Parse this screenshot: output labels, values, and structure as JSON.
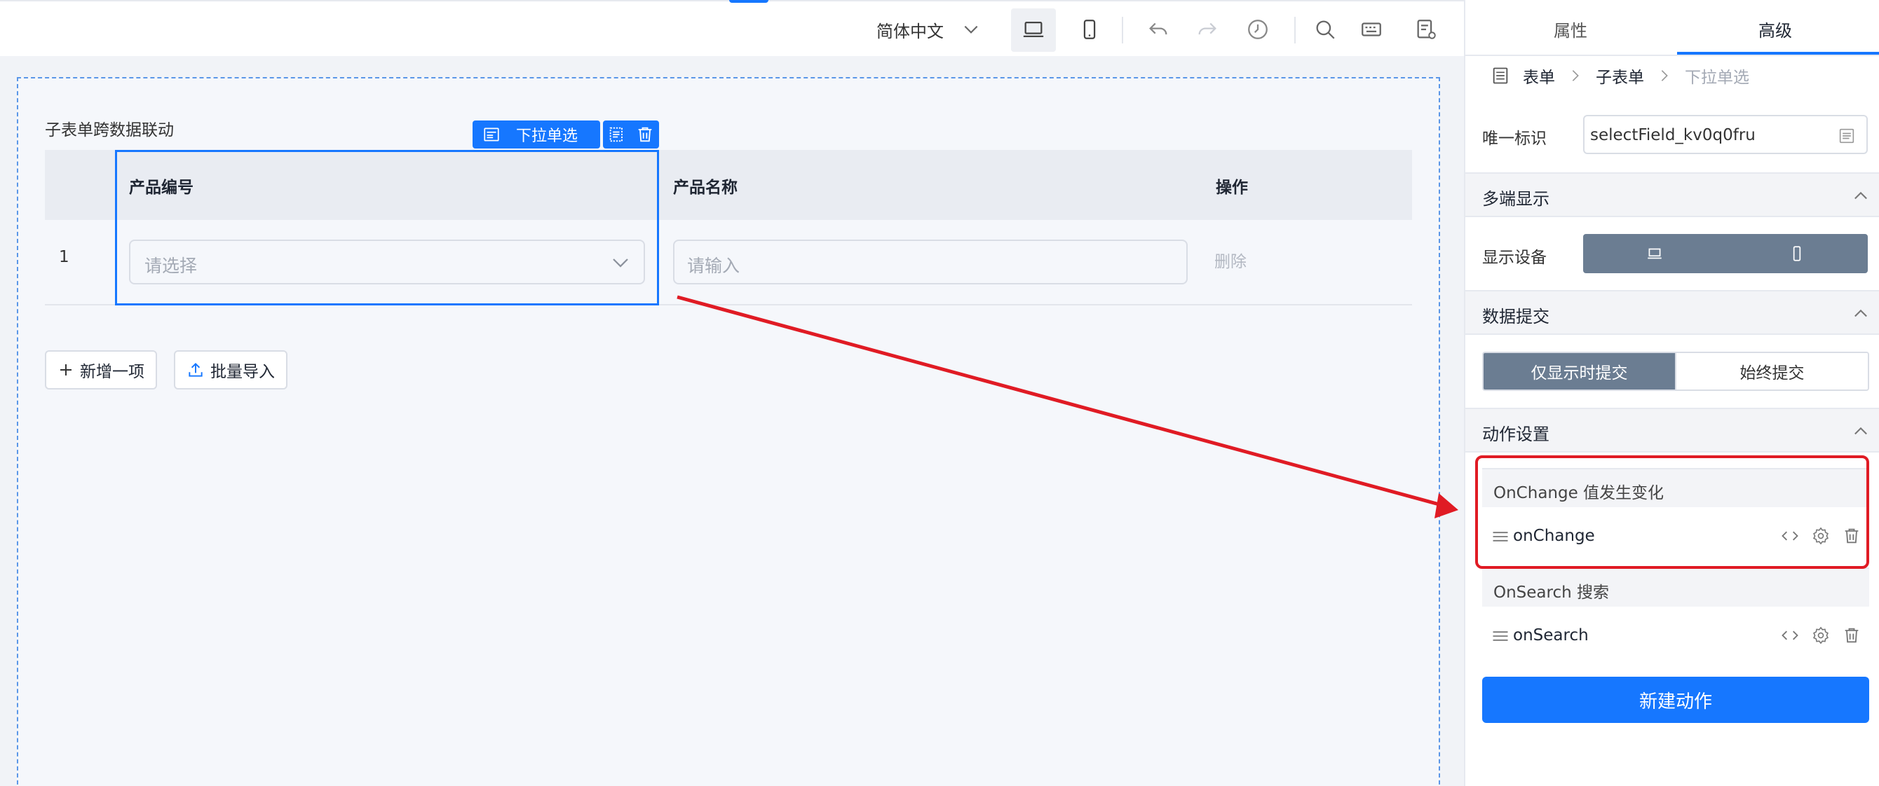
{
  "toolbar": {
    "language": "简体中文",
    "icons": [
      "laptop-icon",
      "mobile-icon",
      "undo-icon",
      "redo-icon",
      "history-icon",
      "search-icon",
      "keyboard-icon",
      "page-settings-icon"
    ]
  },
  "canvas": {
    "form_title": "子表单跨数据联动",
    "selected_badge": "下拉单选",
    "columns": [
      "产品编号",
      "产品名称",
      "操作"
    ],
    "rows": [
      {
        "index": "1",
        "select_placeholder": "请选择",
        "input_placeholder": "请输入",
        "action": "删除"
      }
    ],
    "add_button": "新增一项",
    "import_button": "批量导入"
  },
  "panel": {
    "tabs": [
      "属性",
      "高级"
    ],
    "active_tab": "高级",
    "breadcrumb": [
      "表单",
      "子表单",
      "下拉单选"
    ],
    "unique_id_label": "唯一标识",
    "unique_id_value": "selectField_kv0q0fru",
    "section_multi": "多端显示",
    "display_device_label": "显示设备",
    "section_submit": "数据提交",
    "submit_options": [
      "仅显示时提交",
      "始终提交"
    ],
    "section_actions": "动作设置",
    "events": [
      {
        "header": "OnChange 值发生变化",
        "handler": "onChange"
      },
      {
        "header": "OnSearch 搜索",
        "handler": "onSearch"
      }
    ],
    "new_action_button": "新建动作"
  },
  "colors": {
    "accent": "#1677ff",
    "highlight": "#e01b24",
    "segment_active": "#6b7d92"
  }
}
